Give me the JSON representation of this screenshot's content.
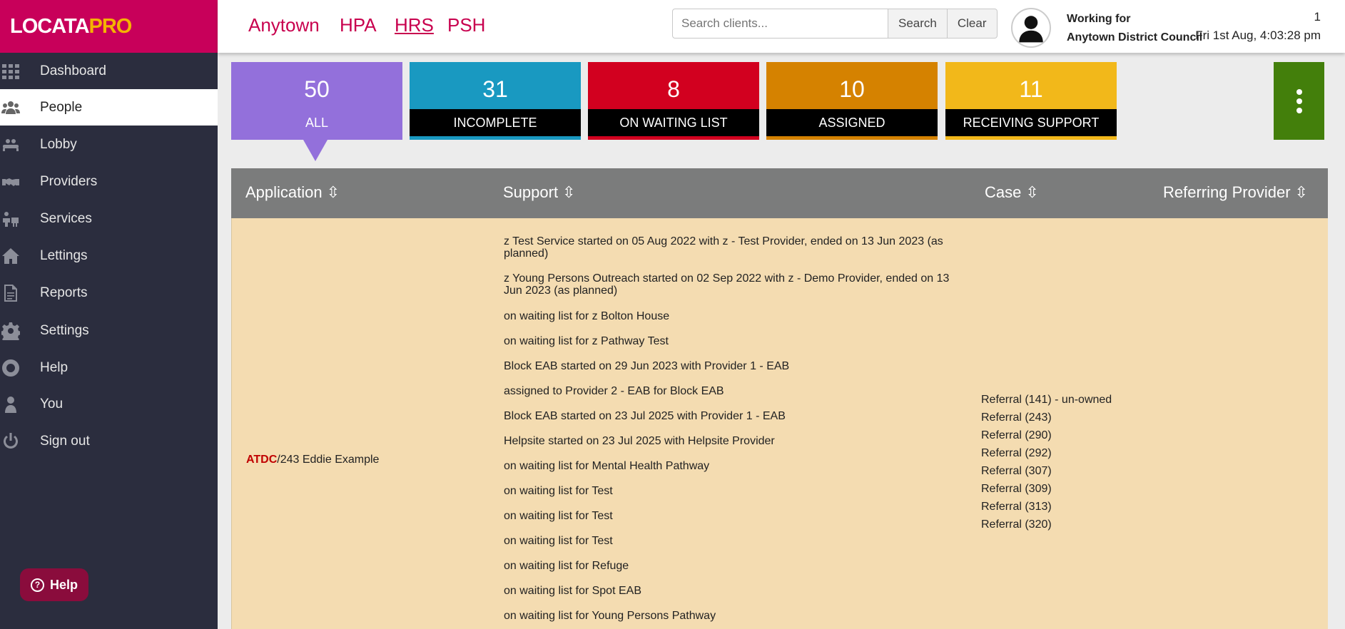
{
  "brand": {
    "logo_part1": "LOCATA",
    "logo_part2": "PRO"
  },
  "sidebar": {
    "items": [
      {
        "label": "Dashboard",
        "icon": "grid-icon"
      },
      {
        "label": "People",
        "icon": "people-icon",
        "active": true
      },
      {
        "label": "Lobby",
        "icon": "lobby-icon"
      },
      {
        "label": "Providers",
        "icon": "handshake-icon"
      },
      {
        "label": "Services",
        "icon": "services-icon"
      },
      {
        "label": "Lettings",
        "icon": "home-icon"
      },
      {
        "label": "Reports",
        "icon": "document-icon"
      },
      {
        "label": "Settings",
        "icon": "gear-icon"
      },
      {
        "label": "Help",
        "icon": "lifebuoy-icon"
      },
      {
        "label": "You",
        "icon": "user-icon"
      },
      {
        "label": "Sign out",
        "icon": "power-icon"
      }
    ],
    "help_button": "Help"
  },
  "header": {
    "orgs": [
      "Anytown",
      "HPA",
      "HRS",
      "PSH"
    ],
    "active_org": "HRS",
    "search_placeholder": "Search clients...",
    "search_label": "Search",
    "clear_label": "Clear",
    "working_for_label": "Working for",
    "working_for_org": "Anytown District Council",
    "notification_count": "1",
    "datetime": "Fri 1st Aug, 4:03:28 pm"
  },
  "tiles": [
    {
      "count": "50",
      "label": "ALL",
      "color": "#9370db"
    },
    {
      "count": "31",
      "label": "INCOMPLETE",
      "color": "#1999c1"
    },
    {
      "count": "8",
      "label": "ON WAITING LIST",
      "color": "#d2001f"
    },
    {
      "count": "10",
      "label": "ASSIGNED",
      "color": "#d58200"
    },
    {
      "count": "11",
      "label": "RECEIVING SUPPORT",
      "color": "#f2b81a"
    }
  ],
  "table": {
    "columns": [
      "Application ⇳",
      "Support ⇳",
      "Case ⇳",
      "Referring Provider ⇳"
    ],
    "row": {
      "app_org": "ATDC",
      "app_rest": "/243 Eddie Example",
      "support": [
        "z Test Service started on 05 Aug 2022 with z - Test Provider, ended on 13 Jun 2023 (as planned)",
        "z Young Persons Outreach started on 02 Sep 2022 with z - Demo Provider, ended on 13 Jun 2023 (as planned)",
        "on waiting list for z Bolton House",
        "on waiting list for z Pathway Test",
        "Block EAB started on 29 Jun 2023 with Provider 1 - EAB",
        "assigned to Provider 2 - EAB for Block EAB",
        "Block EAB started on 23 Jul 2025 with Provider 1 - EAB",
        "Helpsite started on 23 Jul 2025 with Helpsite Provider",
        "on waiting list for Mental Health Pathway",
        "on waiting list for Test",
        "on waiting list for Test",
        "on waiting list for Test",
        "on waiting list for Refuge",
        "on waiting list for Spot EAB",
        "on waiting list for Young Persons Pathway"
      ],
      "cases": [
        "Referral (141) - un-owned",
        "Referral (243)",
        "Referral (290)",
        "Referral (292)",
        "Referral (307)",
        "Referral (309)",
        "Referral (313)",
        "Referral (320)"
      ]
    }
  }
}
